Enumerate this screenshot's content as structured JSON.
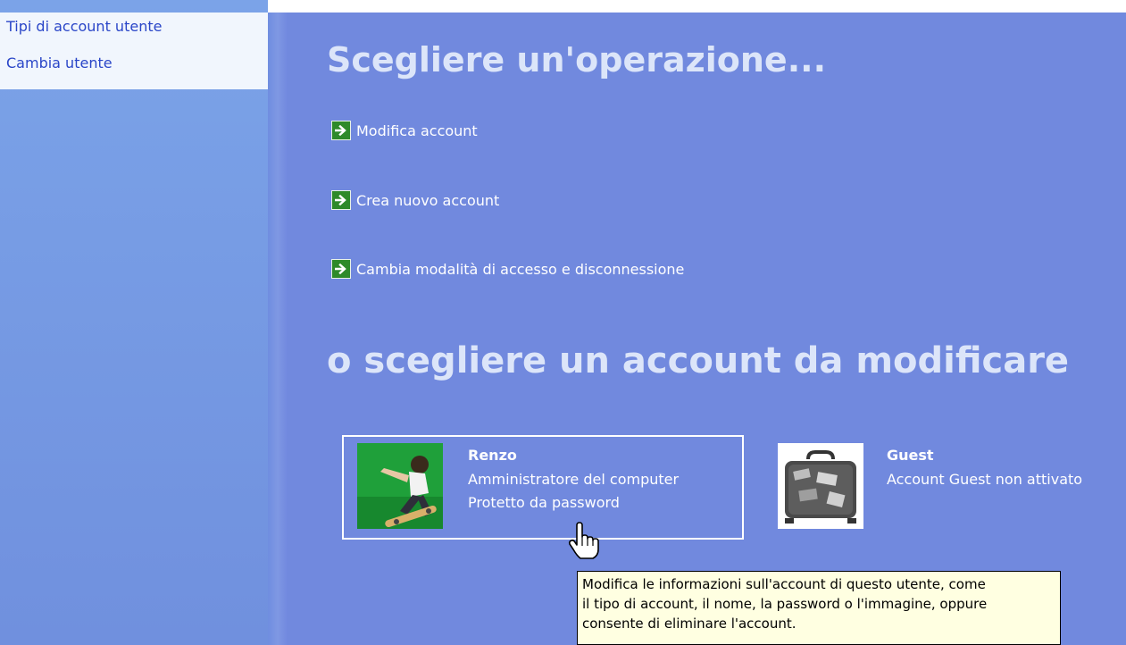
{
  "sidebar": {
    "links": [
      {
        "label": "Tipi di account utente"
      },
      {
        "label": "Cambia utente"
      }
    ]
  },
  "main": {
    "heading_tasks": "Scegliere un'operazione...",
    "tasks": [
      {
        "label": "Modifica account",
        "icon": "green-arrow-icon"
      },
      {
        "label": "Crea nuovo account",
        "icon": "green-arrow-icon"
      },
      {
        "label": "Cambia modalità di accesso e disconnessione",
        "icon": "green-arrow-icon"
      }
    ],
    "heading_accounts": "o scegliere un account da modificare",
    "accounts": [
      {
        "name": "Renzo",
        "lines": [
          "Amministratore del computer",
          "Protetto da password"
        ],
        "picture": "skateboarder-picture",
        "selected": true
      },
      {
        "name": "Guest",
        "lines": [
          "Account Guest non attivato"
        ],
        "picture": "suitcase-picture",
        "selected": false
      }
    ]
  },
  "tooltip": {
    "lines": [
      "Modifica le informazioni sull'account di questo utente, come",
      "il tipo di account, il nome, la password o l'immagine, oppure",
      "consente di eliminare l'account."
    ]
  },
  "colors": {
    "main_bg": "#7189de",
    "heading": "#dce5f9",
    "link": "#2a46c8",
    "arrow_green": "#2e8a2a",
    "tooltip_bg": "#ffffe1"
  }
}
